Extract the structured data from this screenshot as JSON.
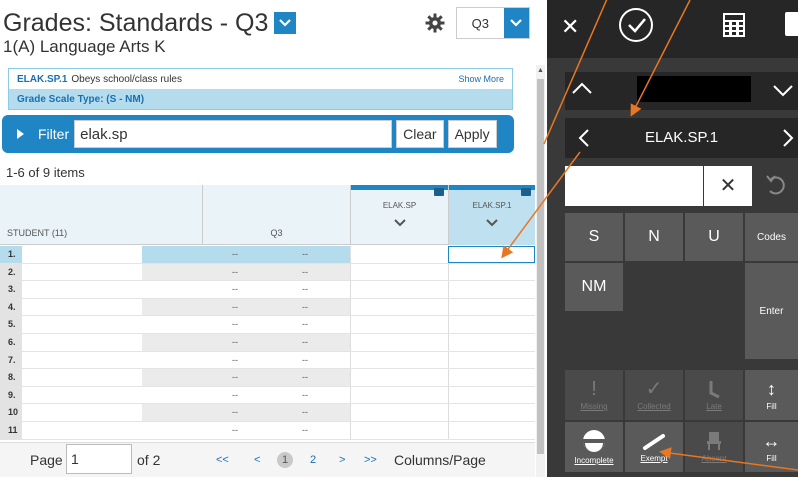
{
  "header": {
    "title": "Grades: Standards - Q3",
    "subtitle": "1(A) Language Arts K",
    "term": "Q3"
  },
  "standard": {
    "code": "ELAK.SP.1",
    "description": "Obeys school/class rules",
    "show_more": "Show More",
    "grade_scale": "Grade Scale Type: (S - NM)"
  },
  "filter": {
    "label": "Filter",
    "value": "elak.sp",
    "clear_label": "Clear",
    "apply_label": "Apply"
  },
  "items_count": "1-6 of 9 items",
  "grid": {
    "student_header": "STUDENT (11)",
    "term_header": "Q3",
    "col_a": "ELAK.SP",
    "col_b": "ELAK.SP.1",
    "rows": [
      {
        "num": "1.",
        "d1": "--",
        "d2": "--"
      },
      {
        "num": "2.",
        "d1": "--",
        "d2": "--"
      },
      {
        "num": "3.",
        "d1": "--",
        "d2": "--"
      },
      {
        "num": "4.",
        "d1": "--",
        "d2": "--"
      },
      {
        "num": "5.",
        "d1": "--",
        "d2": "--"
      },
      {
        "num": "6.",
        "d1": "--",
        "d2": "--"
      },
      {
        "num": "7.",
        "d1": "--",
        "d2": "--"
      },
      {
        "num": "8.",
        "d1": "--",
        "d2": "--"
      },
      {
        "num": "9.",
        "d1": "--",
        "d2": "--"
      },
      {
        "num": "10",
        "d1": "--",
        "d2": "--"
      },
      {
        "num": "11",
        "d1": "--",
        "d2": "--"
      }
    ]
  },
  "pager": {
    "page_label": "Page",
    "page_value": "1",
    "of_label": "of 2",
    "first": "<<",
    "prev": "<",
    "page1": "1",
    "page2": "2",
    "next": ">",
    "last": ">>",
    "columns_label": "Columns/Page"
  },
  "panel": {
    "standard_code": "ELAK.SP.1",
    "keys": {
      "s": "S",
      "n": "N",
      "u": "U",
      "codes": "Codes",
      "nm": "NM",
      "enter": "Enter",
      "missing": "Missing",
      "collected": "Collected",
      "late": "Late",
      "fill": "Fill",
      "incomplete": "Incomplete",
      "exempt": "Exempt",
      "absent": "Absent",
      "fill2": "Fill"
    }
  },
  "colors": {
    "accent": "#1f85c4",
    "selected_row": "#b5dcec",
    "panel_bg": "#393939",
    "annotation_arrow": "#e87722"
  }
}
